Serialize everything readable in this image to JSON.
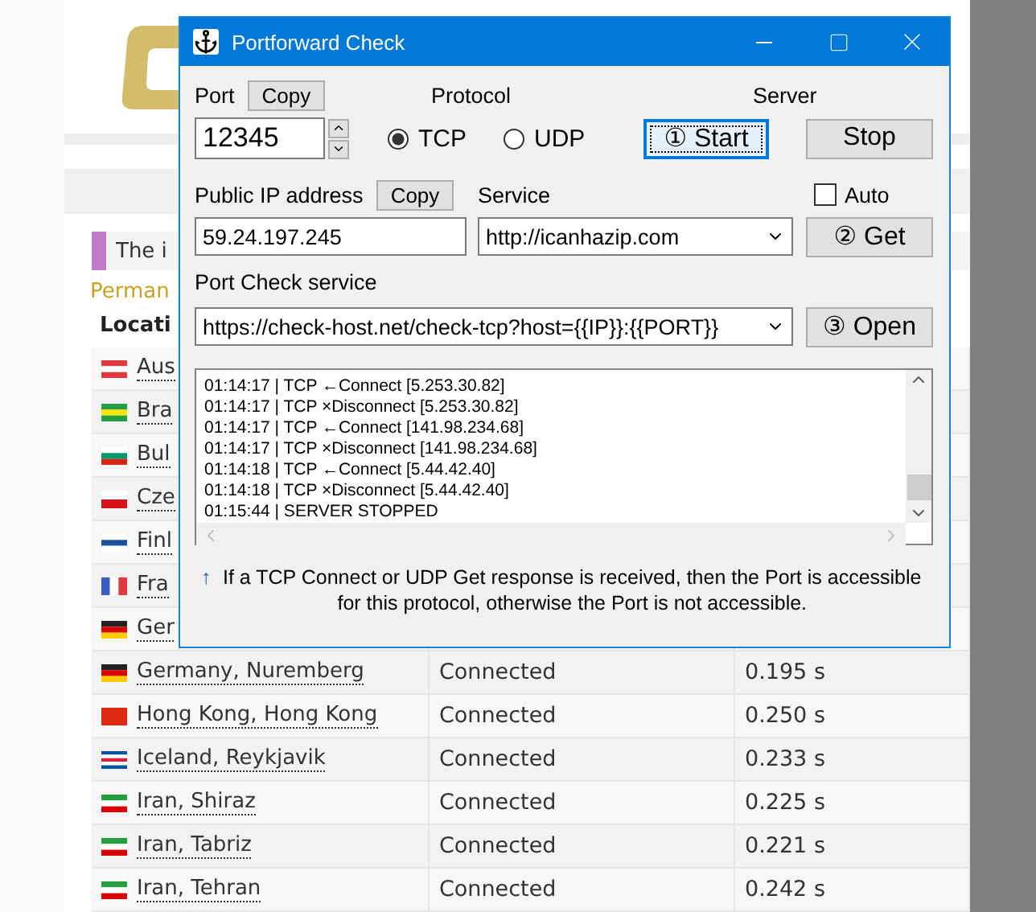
{
  "page": {
    "notice": "The i",
    "link": "Perman",
    "column_1": "Locati",
    "rows": [
      {
        "location": "Aus"
      },
      {
        "location": "Bra"
      },
      {
        "location": "Bul"
      },
      {
        "location": "Cze"
      },
      {
        "location": "Finl"
      },
      {
        "location": "Fra"
      },
      {
        "location": "Ger"
      },
      {
        "location": "Germany, Nuremberg",
        "status": "Connected",
        "time": "0.195 s"
      },
      {
        "location": "Hong Kong, Hong Kong",
        "status": "Connected",
        "time": "0.250 s"
      },
      {
        "location": "Iceland, Reykjavik",
        "status": "Connected",
        "time": "0.233 s"
      },
      {
        "location": "Iran, Shiraz",
        "status": "Connected",
        "time": "0.225 s"
      },
      {
        "location": "Iran, Tabriz",
        "status": "Connected",
        "time": "0.221 s"
      },
      {
        "location": "Iran, Tehran",
        "status": "Connected",
        "time": "0.242 s"
      }
    ]
  },
  "window": {
    "title": "Portforward Check",
    "port_label": "Port",
    "port_copy": "Copy",
    "port": "12345",
    "protocol_label": "Protocol",
    "protocols": [
      {
        "label": "TCP",
        "selected": true
      },
      {
        "label": "UDP",
        "selected": false
      }
    ],
    "server_label": "Server",
    "start": {
      "label": "① Start",
      "focused": true
    },
    "stop": {
      "label": "Stop",
      "focused": false
    },
    "ip_label": "Public IP address",
    "ip_copy": "Copy",
    "ip": "59.24.197.245",
    "service_label": "Service",
    "service": "http://icanhazip.com",
    "auto": {
      "label": "Auto",
      "checked": false
    },
    "get": {
      "label": "② Get",
      "focused": false
    },
    "check_label": "Port Check service",
    "check_url": "https://check-host.net/check-tcp?host={{IP}}:{{PORT}}",
    "open": {
      "label": "③ Open",
      "focused": false
    },
    "log": [
      "01:14:17 | TCP ←Connect [5.253.30.82]",
      "01:14:17 | TCP ×Disconnect [5.253.30.82]",
      "01:14:17 | TCP ←Connect [141.98.234.68]",
      "01:14:17 | TCP ×Disconnect [141.98.234.68]",
      "01:14:18 | TCP ←Connect [5.44.42.40]",
      "01:14:18 | TCP ×Disconnect [5.44.42.40]",
      "01:15:44 | SERVER STOPPED"
    ],
    "hint_arrow": "↑",
    "hint": "If a TCP Connect or UDP Get response is received, then the Port is accessible for this protocol, otherwise the Port is not accessible."
  }
}
